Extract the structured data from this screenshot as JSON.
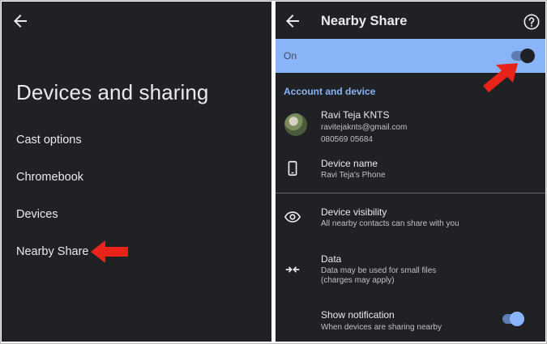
{
  "left": {
    "title": "Devices and sharing",
    "menu": [
      "Cast options",
      "Chromebook",
      "Devices",
      "Nearby Share"
    ]
  },
  "right": {
    "title": "Nearby Share",
    "on_label": "On",
    "on_toggle": true,
    "section_header": "Account and device",
    "account": {
      "name": "Ravi Teja KNTS",
      "email": "ravitejaknts@gmail.com",
      "phone": "080569 05684"
    },
    "device_name": {
      "title": "Device name",
      "value": "Ravi Teja's Phone"
    },
    "device_visibility": {
      "title": "Device visibility",
      "subtitle": "All nearby contacts can share with you"
    },
    "data": {
      "title": "Data",
      "subtitle_1": "Data may be used for small files",
      "subtitle_2": "(charges may apply)"
    },
    "show_notification": {
      "title": "Show notification",
      "subtitle": "When devices are sharing nearby",
      "on": true
    }
  },
  "colors": {
    "background": "#202124",
    "accent_blue": "#8ab4f8",
    "annotation_red": "#e8231a"
  },
  "icons": [
    "back-arrow-icon",
    "help-icon",
    "phone-icon",
    "eye-icon",
    "data-arrows-icon",
    "red-arrow-icon"
  ]
}
